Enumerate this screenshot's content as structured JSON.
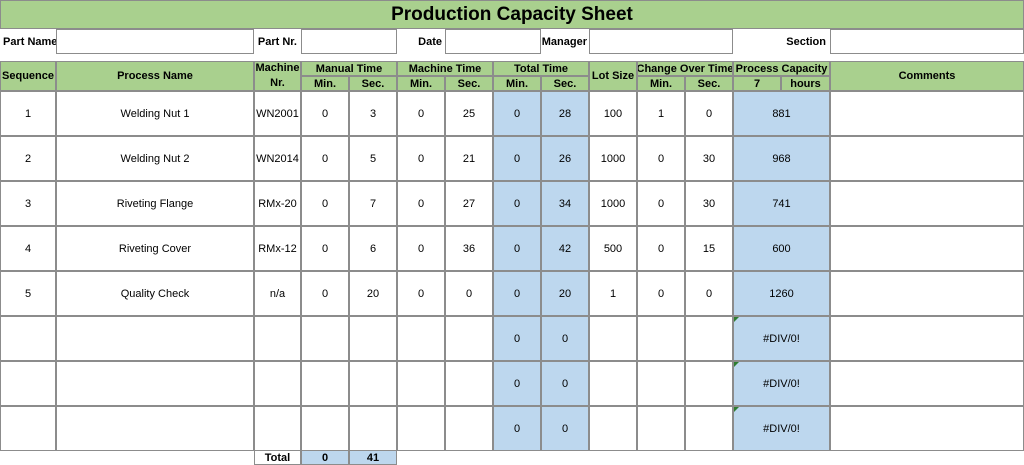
{
  "title": "Production Capacity Sheet",
  "info": {
    "part_name_label": "Part Name",
    "part_nr_label": "Part Nr.",
    "date_label": "Date",
    "manager_label": "Manager",
    "section_label": "Section",
    "part_name_value": "",
    "part_nr_value": "",
    "date_value": "",
    "manager_value": "",
    "section_value": ""
  },
  "headers": {
    "sequence": "Sequence",
    "process_name": "Process Name",
    "machine_nr_top": "Machine",
    "machine_nr_bottom": "Nr.",
    "manual_time": "Manual Time",
    "machine_time": "Machine Time",
    "total_time": "Total Time",
    "lot_size": "Lot Size",
    "change_over_time": "Change Over Time",
    "process_capacity": "Process Capacity",
    "comments": "Comments",
    "min": "Min.",
    "sec": "Sec.",
    "capacity_hours_value": "7",
    "capacity_hours_unit": "hours"
  },
  "rows": [
    {
      "seq": "1",
      "process": "Welding Nut 1",
      "machine": "WN2001",
      "man_min": "0",
      "man_sec": "3",
      "mach_min": "0",
      "mach_sec": "25",
      "tot_min": "0",
      "tot_sec": "28",
      "lot": "100",
      "co_min": "1",
      "co_sec": "0",
      "capacity": "881",
      "comments": ""
    },
    {
      "seq": "2",
      "process": "Welding Nut 2",
      "machine": "WN2014",
      "man_min": "0",
      "man_sec": "5",
      "mach_min": "0",
      "mach_sec": "21",
      "tot_min": "0",
      "tot_sec": "26",
      "lot": "1000",
      "co_min": "0",
      "co_sec": "30",
      "capacity": "968",
      "comments": ""
    },
    {
      "seq": "3",
      "process": "Riveting Flange",
      "machine": "RMx-20",
      "man_min": "0",
      "man_sec": "7",
      "mach_min": "0",
      "mach_sec": "27",
      "tot_min": "0",
      "tot_sec": "34",
      "lot": "1000",
      "co_min": "0",
      "co_sec": "30",
      "capacity": "741",
      "comments": ""
    },
    {
      "seq": "4",
      "process": "Riveting Cover",
      "machine": "RMx-12",
      "man_min": "0",
      "man_sec": "6",
      "mach_min": "0",
      "mach_sec": "36",
      "tot_min": "0",
      "tot_sec": "42",
      "lot": "500",
      "co_min": "0",
      "co_sec": "15",
      "capacity": "600",
      "comments": ""
    },
    {
      "seq": "5",
      "process": "Quality Check",
      "machine": "n/a",
      "man_min": "0",
      "man_sec": "20",
      "mach_min": "0",
      "mach_sec": "0",
      "tot_min": "0",
      "tot_sec": "20",
      "lot": "1",
      "co_min": "0",
      "co_sec": "0",
      "capacity": "1260",
      "comments": ""
    },
    {
      "seq": "",
      "process": "",
      "machine": "",
      "man_min": "",
      "man_sec": "",
      "mach_min": "",
      "mach_sec": "",
      "tot_min": "0",
      "tot_sec": "0",
      "lot": "",
      "co_min": "",
      "co_sec": "",
      "capacity": "#DIV/0!",
      "comments": ""
    },
    {
      "seq": "",
      "process": "",
      "machine": "",
      "man_min": "",
      "man_sec": "",
      "mach_min": "",
      "mach_sec": "",
      "tot_min": "0",
      "tot_sec": "0",
      "lot": "",
      "co_min": "",
      "co_sec": "",
      "capacity": "#DIV/0!",
      "comments": ""
    },
    {
      "seq": "",
      "process": "",
      "machine": "",
      "man_min": "",
      "man_sec": "",
      "mach_min": "",
      "mach_sec": "",
      "tot_min": "0",
      "tot_sec": "0",
      "lot": "",
      "co_min": "",
      "co_sec": "",
      "capacity": "#DIV/0!",
      "comments": ""
    }
  ],
  "total": {
    "label": "Total",
    "manual_min": "0",
    "manual_sec": "41"
  }
}
